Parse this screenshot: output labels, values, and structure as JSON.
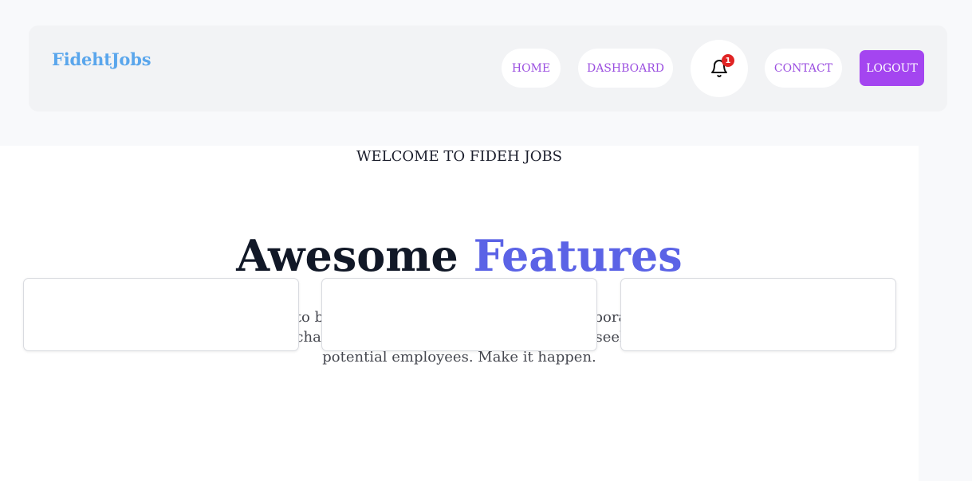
{
  "header": {
    "brand": "FidehtJobs",
    "nav": {
      "home": "HOME",
      "dashboard": "DASHBOARD",
      "contact": "CONTACT",
      "logout": "LOGOUT"
    },
    "notifications": {
      "icon": "bell-icon",
      "count": "1"
    }
  },
  "main": {
    "welcome": "WELCOME TO FIDEH JOBS",
    "headline_part1": "Awesome",
    "headline_part2": "Features",
    "description": "Our aim is to bring people together, help them collaborate on tools that can change the world. While we also link job seekers with potential employees. Make it happen."
  },
  "colors": {
    "brand": "#5aa6ec",
    "nav_text": "#9b4fe0",
    "logout_bg": "#a445f0",
    "accent": "#5b63e6",
    "badge": "#e02424"
  }
}
